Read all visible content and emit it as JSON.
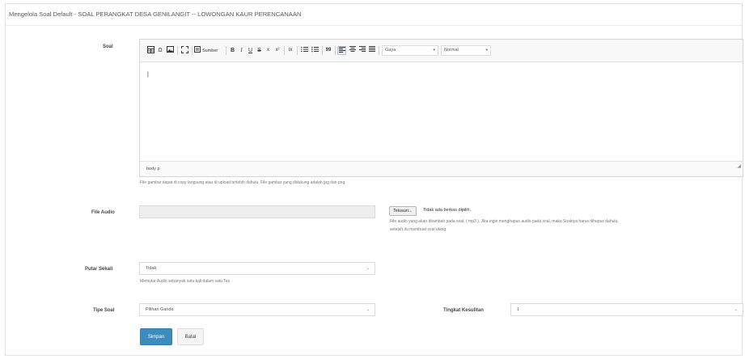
{
  "page": {
    "title": "Mengelola Soal Default - SOAL PERANGKAT DESA GENILANGIT -- LOWONGAN KAUR PERENCANAAN"
  },
  "form": {
    "soal_label": "Soal",
    "editor": {
      "toolbar": {
        "source_label": "Sumber",
        "bold": "B",
        "italic": "I",
        "underline": "U",
        "strike": "S",
        "subscript": "x",
        "superscript": "x²",
        "remove_format": "Ix",
        "blockquote": "99",
        "style_combo": "Gaya",
        "format_combo": "Normal"
      },
      "content": "|",
      "path": "body  p"
    },
    "soal_help": "File gambar dapat di copy langsung atau di upload terlebih dahulu. File gambar yang didukung adalah jpg dan png.",
    "file_audio_label": "File Audio",
    "file_button": "Telusuri...",
    "file_status": "Tidak ada berkas dipilih.",
    "audio_note": "File audio yang akan ditambah pada soal. ( mp3 ). Jika ingin menghapus audio pada soal, maka Soalnya harus dihapus dahulu, setelah itu membuat soal ulang.",
    "putar_label": "Putar Sekali",
    "putar_value": "Tidak",
    "putar_help": "Memutar Audio sebanyak satu kali dalam satu Tes",
    "tipe_label": "Tipe Soal",
    "tipe_value": "Pilihan Ganda",
    "tingkat_label": "Tingkat Kesulitan",
    "tingkat_value": "1",
    "save_button": "Simpan",
    "cancel_button": "Batal"
  },
  "colors": {
    "primary": "#3c8dbc",
    "disabled_input": "#eeeeee",
    "border": "#dadada"
  }
}
